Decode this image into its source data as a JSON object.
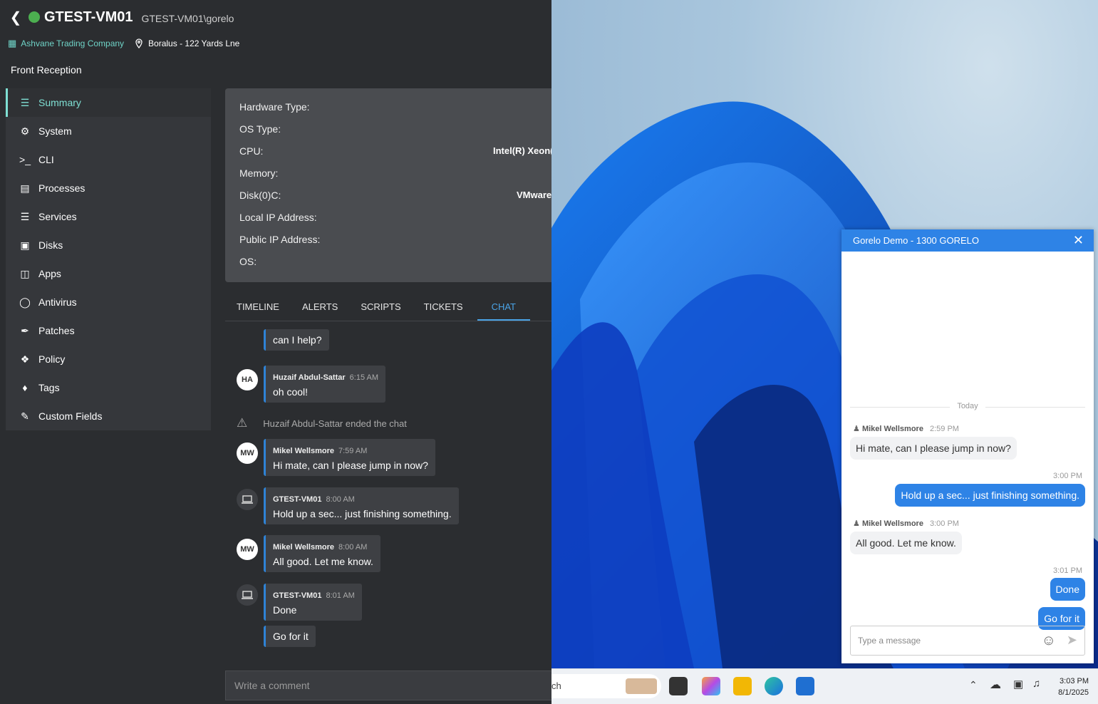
{
  "device": {
    "name": "GTEST-VM01",
    "user": "GTEST-VM01\\gorelo",
    "status_color": "#4caf50"
  },
  "org": {
    "company": "Ashvane Trading Company",
    "location": "Boralus - 122 Yards Lne",
    "site": "Front Reception"
  },
  "nav": [
    {
      "label": "Summary",
      "icon": "summary-icon"
    },
    {
      "label": "System",
      "icon": "gear-icon"
    },
    {
      "label": "CLI",
      "icon": "terminal-icon"
    },
    {
      "label": "Processes",
      "icon": "processes-icon"
    },
    {
      "label": "Services",
      "icon": "services-icon"
    },
    {
      "label": "Disks",
      "icon": "disk-icon"
    },
    {
      "label": "Apps",
      "icon": "apps-icon"
    },
    {
      "label": "Antivirus",
      "icon": "shield-icon"
    },
    {
      "label": "Patches",
      "icon": "wrench-icon"
    },
    {
      "label": "Policy",
      "icon": "puzzle-icon"
    },
    {
      "label": "Tags",
      "icon": "tag-icon"
    },
    {
      "label": "Custom Fields",
      "icon": "edit-icon"
    }
  ],
  "info": [
    {
      "label": "Hardware Type:",
      "value": ""
    },
    {
      "label": "OS Type:",
      "value": ""
    },
    {
      "label": "CPU:",
      "value": "Intel(R) Xeon(R"
    },
    {
      "label": "Memory:",
      "value": ""
    },
    {
      "label": "Disk(0)C:",
      "value": "VMware"
    },
    {
      "label": "Local IP Address:",
      "value": ""
    },
    {
      "label": "Public IP Address:",
      "value": ""
    },
    {
      "label": "OS:",
      "value": ""
    }
  ],
  "tabs": [
    "TIMELINE",
    "ALERTS",
    "SCRIPTS",
    "TICKETS",
    "CHAT"
  ],
  "chat": {
    "m0": {
      "text": "can I help?"
    },
    "m1": {
      "avatar": "HA",
      "name": "Huzaif Abdul-Sattar",
      "time": "6:15 AM",
      "text": "oh cool!"
    },
    "sys": "Huzaif Abdul-Sattar ended the chat",
    "m2": {
      "avatar": "MW",
      "name": "Mikel Wellsmore",
      "time": "7:59 AM",
      "text": "Hi mate, can I please jump in now?"
    },
    "m3": {
      "name": "GTEST-VM01",
      "time": "8:00 AM",
      "text": "Hold up a sec... just finishing something."
    },
    "m4": {
      "avatar": "MW",
      "name": "Mikel Wellsmore",
      "time": "8:00 AM",
      "text": "All good. Let me know."
    },
    "m5": {
      "name": "GTEST-VM01",
      "time": "8:01 AM",
      "text": "Done"
    },
    "m6": {
      "text": "Go for it"
    },
    "comment_placeholder": "Write a comment"
  },
  "popup": {
    "title": "Gorelo Demo - 1300 GORELO",
    "today": "Today",
    "n1": {
      "name": "Mikel Wellsmore",
      "time": "2:59 PM"
    },
    "i1": "Hi mate, can I please jump in now?",
    "t1": "3:00 PM",
    "o1": "Hold up a sec... just finishing something.",
    "n2": {
      "name": "Mikel Wellsmore",
      "time": "3:00 PM"
    },
    "i2": "All good. Let me know.",
    "t2": "3:01 PM",
    "o2": "Done",
    "o3": "Go for it",
    "placeholder": "Type a message"
  },
  "taskbar": {
    "search_text": "ch",
    "time": "3:03 PM",
    "date": "8/1/2025"
  }
}
